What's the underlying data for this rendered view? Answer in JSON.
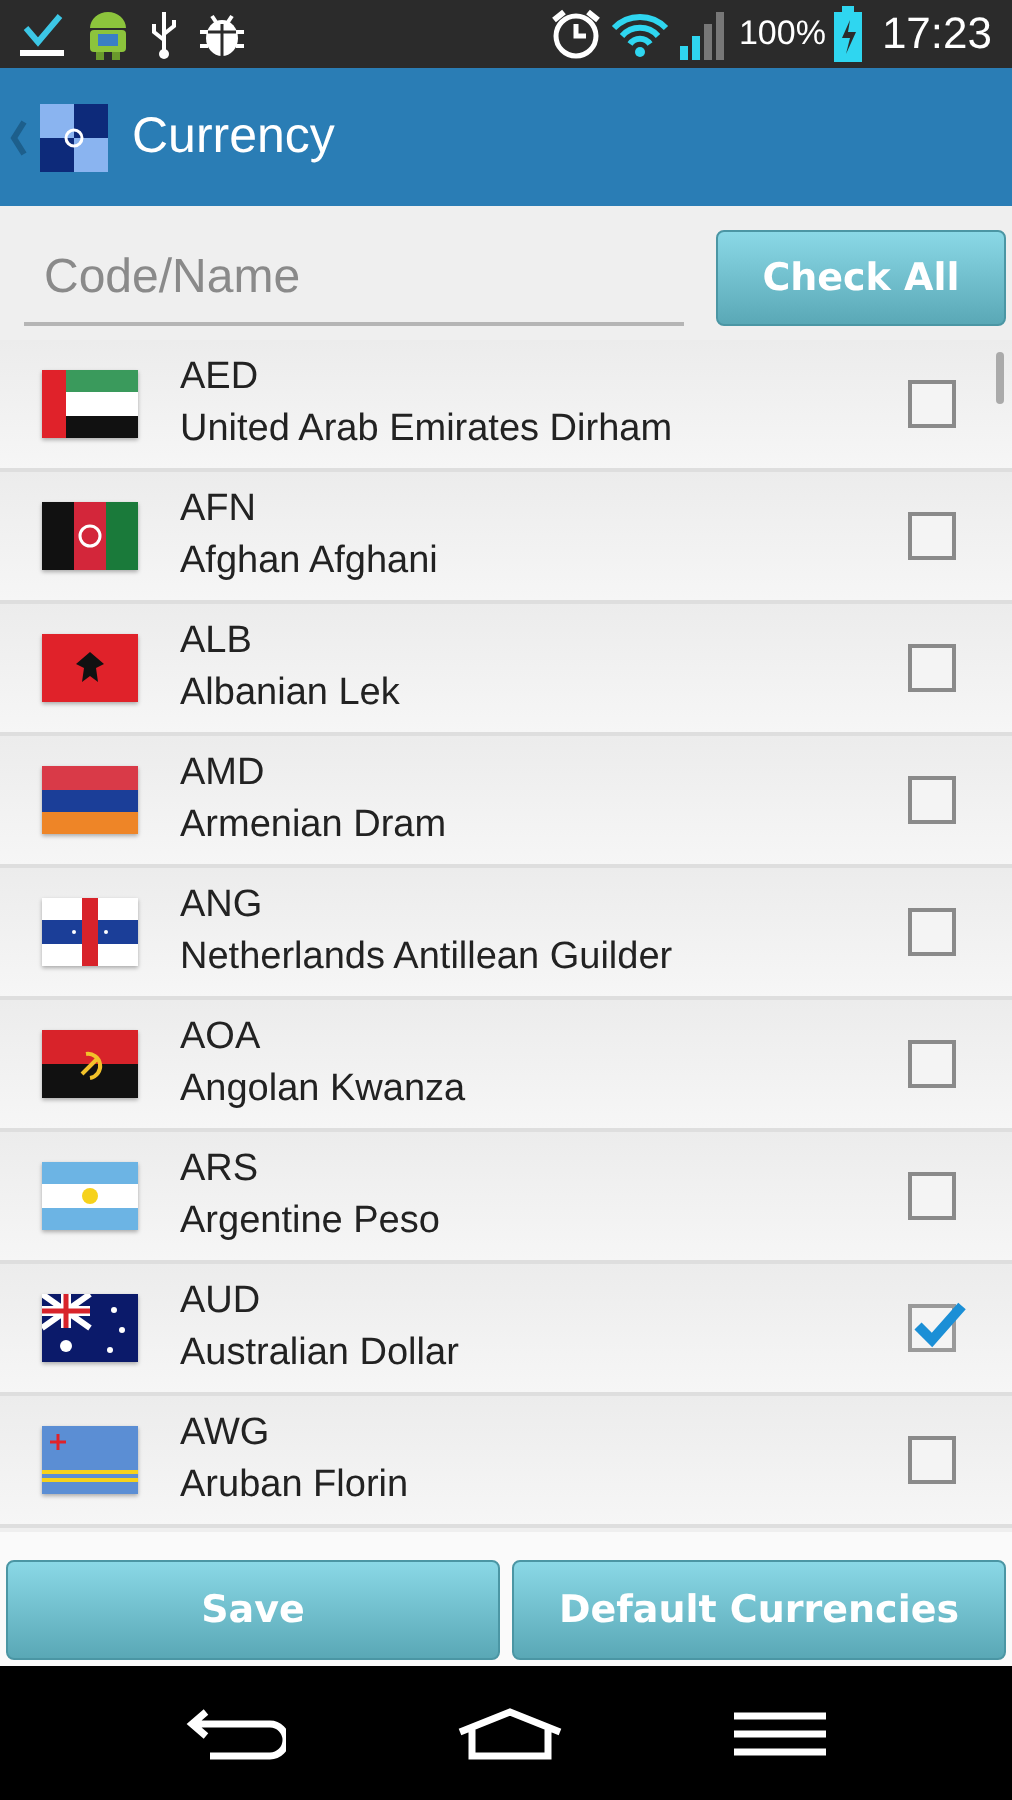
{
  "status_bar": {
    "battery": "100%",
    "time": "17:23"
  },
  "action_bar": {
    "title": "Currency"
  },
  "search": {
    "placeholder": "Code/Name"
  },
  "check_all_button": "Check All",
  "rows": [
    {
      "code": "AED",
      "name": "United Arab Emirates Dirham",
      "checked": false
    },
    {
      "code": "AFN",
      "name": "Afghan Afghani",
      "checked": false
    },
    {
      "code": "ALB",
      "name": "Albanian Lek",
      "checked": false
    },
    {
      "code": "AMD",
      "name": "Armenian Dram",
      "checked": false
    },
    {
      "code": "ANG",
      "name": "Netherlands Antillean Guilder",
      "checked": false
    },
    {
      "code": "AOA",
      "name": "Angolan Kwanza",
      "checked": false
    },
    {
      "code": "ARS",
      "name": "Argentine Peso",
      "checked": false
    },
    {
      "code": "AUD",
      "name": "Australian Dollar",
      "checked": true
    },
    {
      "code": "AWG",
      "name": "Aruban Florin",
      "checked": false
    }
  ],
  "buttons": [
    "Save",
    "Default Currencies"
  ]
}
